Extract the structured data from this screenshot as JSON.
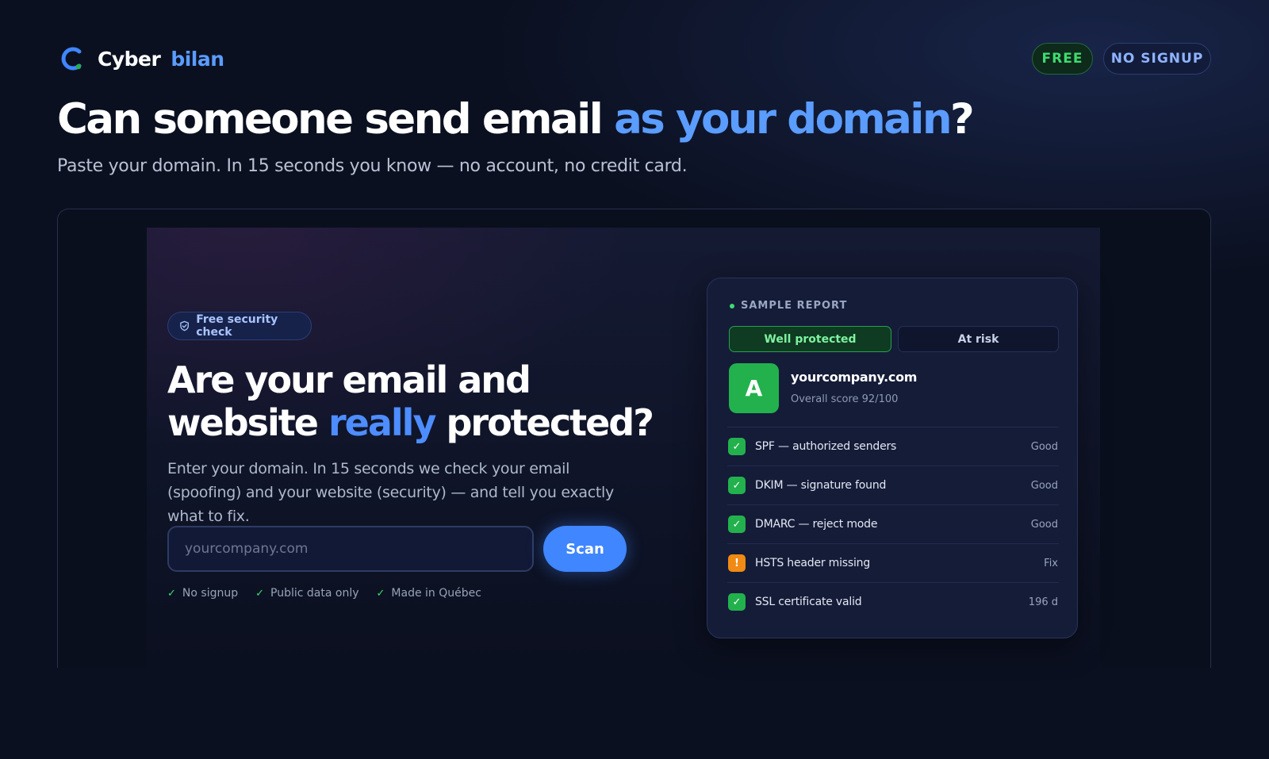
{
  "brand": {
    "word1": "Cyber",
    "word2": "bilan"
  },
  "badges": {
    "free": "FREE",
    "no_signup": "NO SIGNUP"
  },
  "headline": {
    "part1": "Can someone send email ",
    "accent": "as your domain",
    "end": "?"
  },
  "subline": "Paste your domain. In 15 seconds you know — no account, no credit card.",
  "hero": {
    "pill": "Free security check",
    "title_part1": "Are your email and website ",
    "title_accent": "really",
    "title_part2": " protected?",
    "description": "Enter your domain. In 15 seconds we check your email (spoofing) and your website (security) — and tell you exactly what to fix.",
    "input_placeholder": "yourcompany.com",
    "scan_label": "Scan",
    "trust": [
      "No signup",
      "Public data only",
      "Made in Québec"
    ]
  },
  "report": {
    "label": "SAMPLE REPORT",
    "tabs": [
      "Well protected",
      "At risk"
    ],
    "grade": "A",
    "site": "yourcompany.com",
    "score": "Overall score 92/100",
    "checks": [
      {
        "label": "SPF — authorized senders",
        "status": "Good",
        "icon": "check-icon"
      },
      {
        "label": "DKIM — signature found",
        "status": "Good",
        "icon": "check-icon"
      },
      {
        "label": "DMARC — reject mode",
        "status": "Good",
        "icon": "check-icon"
      },
      {
        "label": "HSTS header missing",
        "status": "Fix",
        "icon": "warning-icon"
      },
      {
        "label": "SSL certificate valid",
        "status": "196 d",
        "icon": "check-icon"
      }
    ]
  },
  "colors": {
    "accent": "#5b9cff",
    "good": "#23b14d",
    "warn": "#f08a14",
    "background": "#0b1020"
  }
}
